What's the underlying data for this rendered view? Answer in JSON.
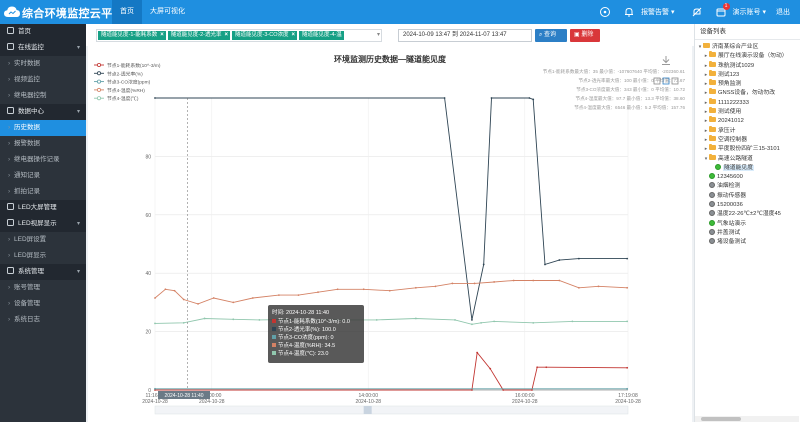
{
  "app": {
    "title": "综合环境监控云平台",
    "nav": [
      "首页",
      "大屏可视化"
    ],
    "alarm_label": "报警告警",
    "user_label": "演示账号",
    "logout_label": "退出",
    "notification_count": "1"
  },
  "sidebar": {
    "items": [
      {
        "type": "group",
        "label": "首页",
        "icon": "home-icon",
        "caret": ""
      },
      {
        "type": "group",
        "label": "在线监控",
        "icon": "monitor-icon",
        "caret": "▾"
      },
      {
        "type": "sub",
        "label": "实时数据"
      },
      {
        "type": "sub",
        "label": "视频监控"
      },
      {
        "type": "sub",
        "label": "继电器控制"
      },
      {
        "type": "group",
        "label": "数据中心",
        "icon": "data-icon",
        "caret": "▾"
      },
      {
        "type": "sub",
        "label": "历史数据",
        "active": true
      },
      {
        "type": "sub",
        "label": "报警数据"
      },
      {
        "type": "sub",
        "label": "继电器操作记录"
      },
      {
        "type": "sub",
        "label": "通知记录"
      },
      {
        "type": "sub",
        "label": "抓拍记录"
      },
      {
        "type": "group",
        "label": "LED大屏管理",
        "icon": "led-icon",
        "caret": ""
      },
      {
        "type": "group",
        "label": "LED视屏显示",
        "icon": "led-display-icon",
        "caret": "▾"
      },
      {
        "type": "sub",
        "label": "LED屏设置"
      },
      {
        "type": "sub",
        "label": "LED屏显示"
      },
      {
        "type": "group",
        "label": "系统管理",
        "icon": "gear-icon",
        "caret": "▾"
      },
      {
        "type": "sub",
        "label": "账号管理"
      },
      {
        "type": "sub",
        "label": "设备管理"
      },
      {
        "type": "sub",
        "label": "系统日志"
      }
    ]
  },
  "toolbar": {
    "tags": [
      "隧道能见度-1-能耗系数",
      "隧道能见度-2-透光率",
      "隧道能见度-3-CO浓度",
      "隧道能见度-4-温"
    ],
    "date_range": "2024-10-09 13:47 到 2024-11-07 13:47",
    "query_label": "查询",
    "delete_label": "删除"
  },
  "chart_data": {
    "type": "line",
    "title": "环境监测历史数据—隧道能见度",
    "legend": [
      "节点1-能耗系数(10^-3/m)",
      "节点2-透光率(%)",
      "节点3-CO浓度(ppm)",
      "节点4-温度(%RH)",
      "节点4-温度(℃)"
    ],
    "stats": [
      "节点1-能耗系数最大值：35  最小值：-107607640  平均值：-202360.61",
      "节点2-透光率最大值：100  最小值：0  平均值：73.67",
      "节点3-CO浓度最大值：343  最小值：0  平均值：10.72",
      "节点4-湿度最大值：97.7  最小值：13.3  平均值：38.60",
      "节点4-温度最大值：6546  最小值：5.2  平均值：157.76"
    ],
    "y_ticks": [
      "0",
      "20",
      "40",
      "60",
      "80"
    ],
    "ylim": [
      0,
      100
    ],
    "x_ticks": [
      {
        "time": "11:16:29",
        "date": "2024-10-28"
      },
      {
        "time": "12:00:00",
        "date": "2024-10-28"
      },
      {
        "time": "14:00:00",
        "date": "2024-10-28"
      },
      {
        "time": "16:00:00",
        "date": "2024-10-28"
      },
      {
        "time": "17:19:08",
        "date": "2024-10-28"
      }
    ],
    "x_range_minutes": [
      0,
      362.65
    ],
    "x_tick_minutes": [
      0,
      43.5,
      163.5,
      283.5,
      362.65
    ],
    "series": [
      {
        "name": "节点1-能耗系数(10^-3/m)",
        "color": "#c23531",
        "points": [
          [
            0,
            0
          ],
          [
            243,
            0
          ],
          [
            247,
            12.8
          ],
          [
            257,
            7.3
          ],
          [
            267,
            0
          ],
          [
            289,
            0
          ],
          [
            293,
            7.8
          ],
          [
            300,
            7.8
          ],
          [
            362,
            7.6
          ]
        ]
      },
      {
        "name": "节点2-透光率(%)",
        "color": "#2f4554",
        "points": [
          [
            0,
            100
          ],
          [
            222,
            100
          ],
          [
            243,
            24
          ],
          [
            252,
            43
          ],
          [
            258,
            100
          ],
          [
            287,
            100
          ],
          [
            290,
            99.5
          ],
          [
            299,
            43
          ],
          [
            310,
            44.5
          ],
          [
            325,
            45
          ],
          [
            362,
            45
          ]
        ]
      },
      {
        "name": "节点3-CO浓度(ppm)",
        "color": "#61a0a8",
        "points": [
          [
            0,
            0.4
          ],
          [
            362,
            0.4
          ]
        ]
      },
      {
        "name": "节点4-温度(%RH)",
        "color": "#d48265",
        "points": [
          [
            0,
            31.5
          ],
          [
            8,
            34.5
          ],
          [
            15,
            34
          ],
          [
            22,
            31
          ],
          [
            33,
            29.5
          ],
          [
            45,
            31.5
          ],
          [
            60,
            30
          ],
          [
            75,
            31.5
          ],
          [
            95,
            32.5
          ],
          [
            110,
            32.5
          ],
          [
            125,
            33.5
          ],
          [
            140,
            34.5
          ],
          [
            160,
            34.5
          ],
          [
            180,
            34
          ],
          [
            200,
            35
          ],
          [
            215,
            35.5
          ],
          [
            228,
            36.5
          ],
          [
            245,
            36.5
          ],
          [
            260,
            37
          ],
          [
            275,
            37.5
          ],
          [
            290,
            37.5
          ],
          [
            310,
            37.5
          ],
          [
            325,
            35
          ],
          [
            340,
            35.5
          ],
          [
            362,
            35
          ]
        ]
      },
      {
        "name": "节点4-温度(℃)",
        "color": "#91c7ae",
        "points": [
          [
            0,
            22.8
          ],
          [
            22,
            23
          ],
          [
            38,
            24.5
          ],
          [
            60,
            24.2
          ],
          [
            80,
            24
          ],
          [
            110,
            24.2
          ],
          [
            140,
            24
          ],
          [
            170,
            24
          ],
          [
            200,
            24.5
          ],
          [
            230,
            24
          ],
          [
            243,
            22.5
          ],
          [
            250,
            23
          ],
          [
            260,
            23.5
          ],
          [
            290,
            23
          ],
          [
            320,
            23.5
          ],
          [
            362,
            23.5
          ]
        ]
      }
    ],
    "crosshair_minute": 25,
    "crosshair_label": "2024-10-28 11:40",
    "tooltip": {
      "time": "时间: 2024-10-28 11:40",
      "rows": [
        {
          "text": "节点1-能耗系数(10^-3/m): 0.0",
          "color": "#c23531"
        },
        {
          "text": "节点2-透光率(%): 100.0",
          "color": "#2f4554"
        },
        {
          "text": "节点3-CO浓度(ppm): 0",
          "color": "#61a0a8"
        },
        {
          "text": "节点4-温度(%RH): 34.5",
          "color": "#d48265"
        },
        {
          "text": "节点4-温度(℃): 23.0",
          "color": "#91c7ae"
        }
      ]
    }
  },
  "device_panel": {
    "title": "设备列表",
    "tree": [
      {
        "level": 0,
        "kind": "folder",
        "caret": "▾",
        "label": "济南某综合产业区"
      },
      {
        "level": 1,
        "kind": "folder",
        "caret": "▸",
        "label": "展厅在线演示设备（勿动）"
      },
      {
        "level": 1,
        "kind": "folder",
        "caret": "▸",
        "label": "珠航测试1029"
      },
      {
        "level": 1,
        "kind": "folder",
        "caret": "▸",
        "label": "测试123"
      },
      {
        "level": 1,
        "kind": "folder",
        "caret": "▸",
        "label": "预角监测"
      },
      {
        "level": 1,
        "kind": "folder",
        "caret": "▸",
        "label": "GNSS设备，勿动勿改"
      },
      {
        "level": 1,
        "kind": "folder",
        "caret": "▸",
        "label": "1111222333"
      },
      {
        "level": 1,
        "kind": "folder",
        "caret": "▸",
        "label": "测试使用"
      },
      {
        "level": 1,
        "kind": "folder",
        "caret": "▸",
        "label": "20241012"
      },
      {
        "level": 1,
        "kind": "folder",
        "caret": "▸",
        "label": "承压计"
      },
      {
        "level": 1,
        "kind": "folder",
        "caret": "▸",
        "label": "空调控制器"
      },
      {
        "level": 1,
        "kind": "folder",
        "caret": "▸",
        "label": "平度股份四矿三15-3101"
      },
      {
        "level": 1,
        "kind": "folder",
        "caret": "▾",
        "label": "高速公路隧道"
      },
      {
        "level": 2,
        "kind": "green",
        "caret": "",
        "label": "隧道能见度",
        "selected": true
      },
      {
        "level": 1,
        "kind": "green",
        "caret": "",
        "label": "12345600"
      },
      {
        "level": 1,
        "kind": "gray",
        "caret": "",
        "label": "油烟检测"
      },
      {
        "level": 1,
        "kind": "gray",
        "caret": "",
        "label": "振动传感器"
      },
      {
        "level": 1,
        "kind": "gray",
        "caret": "",
        "label": "15200036"
      },
      {
        "level": 1,
        "kind": "gray",
        "caret": "",
        "label": "温度22-26℃±2℃湿度45"
      },
      {
        "level": 1,
        "kind": "green",
        "caret": "",
        "label": "气象站演示"
      },
      {
        "level": 1,
        "kind": "gray",
        "caret": "",
        "label": "井盖测试"
      },
      {
        "level": 1,
        "kind": "gray",
        "caret": "",
        "label": "堵设备测试"
      }
    ]
  }
}
